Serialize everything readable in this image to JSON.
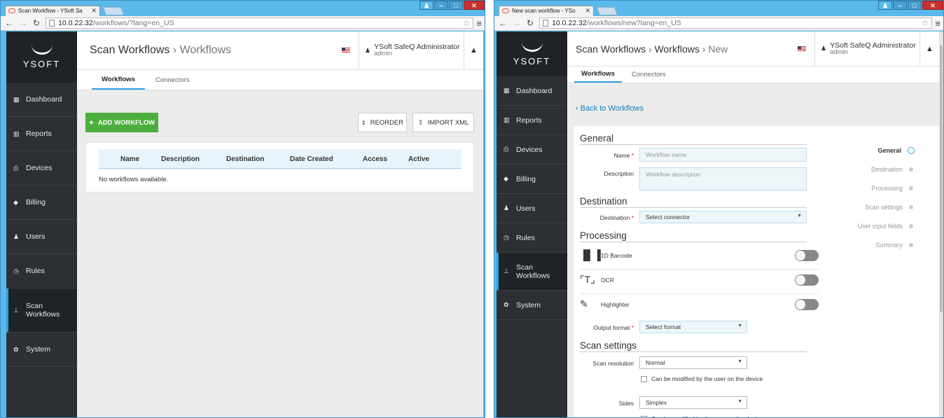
{
  "left": {
    "browser": {
      "tab_title": "Scan Workflow - YSoft Sa",
      "url_host": "10.0.22.32",
      "url_path": "/workflows/?lang=en_US"
    },
    "logo": "YSOFT",
    "sidebar": [
      {
        "icon": "dashboard-icon",
        "label": "Dashboard"
      },
      {
        "icon": "reports-icon",
        "label": "Reports"
      },
      {
        "icon": "printer-icon",
        "label": "Devices"
      },
      {
        "icon": "tag-icon",
        "label": "Billing"
      },
      {
        "icon": "user-icon",
        "label": "Users"
      },
      {
        "icon": "clock-icon",
        "label": "Rules"
      },
      {
        "icon": "sitemap-icon",
        "label": "Scan Workflows",
        "label_line1": "Scan",
        "label_line2": "Workflows",
        "active": true
      },
      {
        "icon": "gear-icon",
        "label": "System"
      }
    ],
    "header": {
      "crumb1": "Scan Workflows",
      "sep": "›",
      "crumb2": "Workflows",
      "user_name": "YSoft SafeQ Administrator",
      "user_role": "admin"
    },
    "tabs": [
      "Workflows",
      "Connectors"
    ],
    "buttons": {
      "add": "ADD WORKFLOW",
      "reorder": "REORDER",
      "import": "IMPORT XML"
    },
    "table": {
      "columns": [
        "Name",
        "Description",
        "Destination",
        "Date Created",
        "Access",
        "Active"
      ],
      "empty_text": "No workflows available."
    }
  },
  "right": {
    "browser": {
      "tab_title": "New scan workflow - YSo",
      "url_host": "10.0.22.32",
      "url_path": "/workflows/new?lang=en_US"
    },
    "logo": "YSOFT",
    "sidebar": [
      {
        "icon": "dashboard-icon",
        "label": "Dashboard"
      },
      {
        "icon": "reports-icon",
        "label": "Reports"
      },
      {
        "icon": "printer-icon",
        "label": "Devices"
      },
      {
        "icon": "tag-icon",
        "label": "Billing"
      },
      {
        "icon": "user-icon",
        "label": "Users"
      },
      {
        "icon": "clock-icon",
        "label": "Rules"
      },
      {
        "icon": "sitemap-icon",
        "label": "Scan Workflows",
        "label_line1": "Scan",
        "label_line2": "Workflows",
        "active": true
      },
      {
        "icon": "gear-icon",
        "label": "System"
      }
    ],
    "header": {
      "crumb1": "Scan Workflows",
      "sep": "›",
      "crumb2": "Workflows",
      "crumb3": "New",
      "user_name": "YSoft SafeQ Administrator",
      "user_role": "admin"
    },
    "tabs": [
      "Workflows",
      "Connectors"
    ],
    "back_link": "Back to Workflows",
    "form": {
      "general_title": "General",
      "name_label": "Name",
      "name_placeholder": "Workflow name",
      "description_label": "Description",
      "description_placeholder": "Workflow description",
      "destination_title": "Destination",
      "destination_label": "Destination",
      "destination_value": "Select connector",
      "processing_title": "Processing",
      "processing_items": [
        "1D Barcode",
        "OCR",
        "Highlighter"
      ],
      "output_format_label": "Output format",
      "output_format_value": "Select format",
      "scan_settings_title": "Scan settings",
      "scan_resolution_label": "Scan resolution",
      "scan_resolution_value": "Normal",
      "modifiable_text": "Can be modified by the user on the device",
      "sides_label": "Sides",
      "sides_value": "Simplex",
      "required_mark": "*"
    },
    "steps": [
      "General",
      "Destination",
      "Processing",
      "Scan settings",
      "User input fields",
      "Summary"
    ]
  }
}
